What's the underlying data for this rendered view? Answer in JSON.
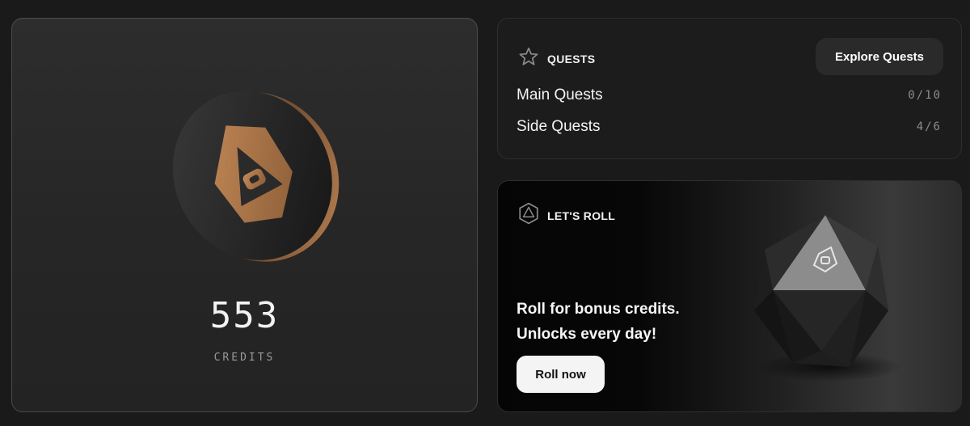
{
  "credits": {
    "value": "553",
    "label": "CREDITS"
  },
  "quests": {
    "title": "QUESTS",
    "explore_label": "Explore Quests",
    "rows": [
      {
        "name": "Main Quests",
        "count": "0/10"
      },
      {
        "name": "Side Quests",
        "count": "4/6"
      }
    ]
  },
  "roll": {
    "title": "LET'S ROLL",
    "line1": "Roll for bonus credits.",
    "line2": "Unlocks every day!",
    "button_label": "Roll now"
  },
  "colors": {
    "bronze": "#b07a4c",
    "card": "#1c1c1c",
    "page": "#1a1a1a"
  },
  "icons": {
    "quests": "star-icon",
    "roll": "d20-icon",
    "coin": "credit-coin-icon"
  }
}
